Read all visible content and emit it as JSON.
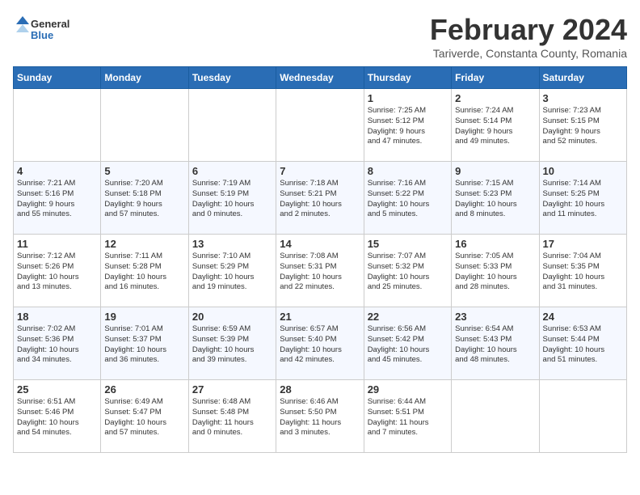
{
  "header": {
    "logo_general": "General",
    "logo_blue": "Blue",
    "month_year": "February 2024",
    "location": "Tariverde, Constanta County, Romania"
  },
  "days_of_week": [
    "Sunday",
    "Monday",
    "Tuesday",
    "Wednesday",
    "Thursday",
    "Friday",
    "Saturday"
  ],
  "weeks": [
    [
      {
        "day": "",
        "info": ""
      },
      {
        "day": "",
        "info": ""
      },
      {
        "day": "",
        "info": ""
      },
      {
        "day": "",
        "info": ""
      },
      {
        "day": "1",
        "info": "Sunrise: 7:25 AM\nSunset: 5:12 PM\nDaylight: 9 hours\nand 47 minutes."
      },
      {
        "day": "2",
        "info": "Sunrise: 7:24 AM\nSunset: 5:14 PM\nDaylight: 9 hours\nand 49 minutes."
      },
      {
        "day": "3",
        "info": "Sunrise: 7:23 AM\nSunset: 5:15 PM\nDaylight: 9 hours\nand 52 minutes."
      }
    ],
    [
      {
        "day": "4",
        "info": "Sunrise: 7:21 AM\nSunset: 5:16 PM\nDaylight: 9 hours\nand 55 minutes."
      },
      {
        "day": "5",
        "info": "Sunrise: 7:20 AM\nSunset: 5:18 PM\nDaylight: 9 hours\nand 57 minutes."
      },
      {
        "day": "6",
        "info": "Sunrise: 7:19 AM\nSunset: 5:19 PM\nDaylight: 10 hours\nand 0 minutes."
      },
      {
        "day": "7",
        "info": "Sunrise: 7:18 AM\nSunset: 5:21 PM\nDaylight: 10 hours\nand 2 minutes."
      },
      {
        "day": "8",
        "info": "Sunrise: 7:16 AM\nSunset: 5:22 PM\nDaylight: 10 hours\nand 5 minutes."
      },
      {
        "day": "9",
        "info": "Sunrise: 7:15 AM\nSunset: 5:23 PM\nDaylight: 10 hours\nand 8 minutes."
      },
      {
        "day": "10",
        "info": "Sunrise: 7:14 AM\nSunset: 5:25 PM\nDaylight: 10 hours\nand 11 minutes."
      }
    ],
    [
      {
        "day": "11",
        "info": "Sunrise: 7:12 AM\nSunset: 5:26 PM\nDaylight: 10 hours\nand 13 minutes."
      },
      {
        "day": "12",
        "info": "Sunrise: 7:11 AM\nSunset: 5:28 PM\nDaylight: 10 hours\nand 16 minutes."
      },
      {
        "day": "13",
        "info": "Sunrise: 7:10 AM\nSunset: 5:29 PM\nDaylight: 10 hours\nand 19 minutes."
      },
      {
        "day": "14",
        "info": "Sunrise: 7:08 AM\nSunset: 5:31 PM\nDaylight: 10 hours\nand 22 minutes."
      },
      {
        "day": "15",
        "info": "Sunrise: 7:07 AM\nSunset: 5:32 PM\nDaylight: 10 hours\nand 25 minutes."
      },
      {
        "day": "16",
        "info": "Sunrise: 7:05 AM\nSunset: 5:33 PM\nDaylight: 10 hours\nand 28 minutes."
      },
      {
        "day": "17",
        "info": "Sunrise: 7:04 AM\nSunset: 5:35 PM\nDaylight: 10 hours\nand 31 minutes."
      }
    ],
    [
      {
        "day": "18",
        "info": "Sunrise: 7:02 AM\nSunset: 5:36 PM\nDaylight: 10 hours\nand 34 minutes."
      },
      {
        "day": "19",
        "info": "Sunrise: 7:01 AM\nSunset: 5:37 PM\nDaylight: 10 hours\nand 36 minutes."
      },
      {
        "day": "20",
        "info": "Sunrise: 6:59 AM\nSunset: 5:39 PM\nDaylight: 10 hours\nand 39 minutes."
      },
      {
        "day": "21",
        "info": "Sunrise: 6:57 AM\nSunset: 5:40 PM\nDaylight: 10 hours\nand 42 minutes."
      },
      {
        "day": "22",
        "info": "Sunrise: 6:56 AM\nSunset: 5:42 PM\nDaylight: 10 hours\nand 45 minutes."
      },
      {
        "day": "23",
        "info": "Sunrise: 6:54 AM\nSunset: 5:43 PM\nDaylight: 10 hours\nand 48 minutes."
      },
      {
        "day": "24",
        "info": "Sunrise: 6:53 AM\nSunset: 5:44 PM\nDaylight: 10 hours\nand 51 minutes."
      }
    ],
    [
      {
        "day": "25",
        "info": "Sunrise: 6:51 AM\nSunset: 5:46 PM\nDaylight: 10 hours\nand 54 minutes."
      },
      {
        "day": "26",
        "info": "Sunrise: 6:49 AM\nSunset: 5:47 PM\nDaylight: 10 hours\nand 57 minutes."
      },
      {
        "day": "27",
        "info": "Sunrise: 6:48 AM\nSunset: 5:48 PM\nDaylight: 11 hours\nand 0 minutes."
      },
      {
        "day": "28",
        "info": "Sunrise: 6:46 AM\nSunset: 5:50 PM\nDaylight: 11 hours\nand 3 minutes."
      },
      {
        "day": "29",
        "info": "Sunrise: 6:44 AM\nSunset: 5:51 PM\nDaylight: 11 hours\nand 7 minutes."
      },
      {
        "day": "",
        "info": ""
      },
      {
        "day": "",
        "info": ""
      }
    ]
  ]
}
